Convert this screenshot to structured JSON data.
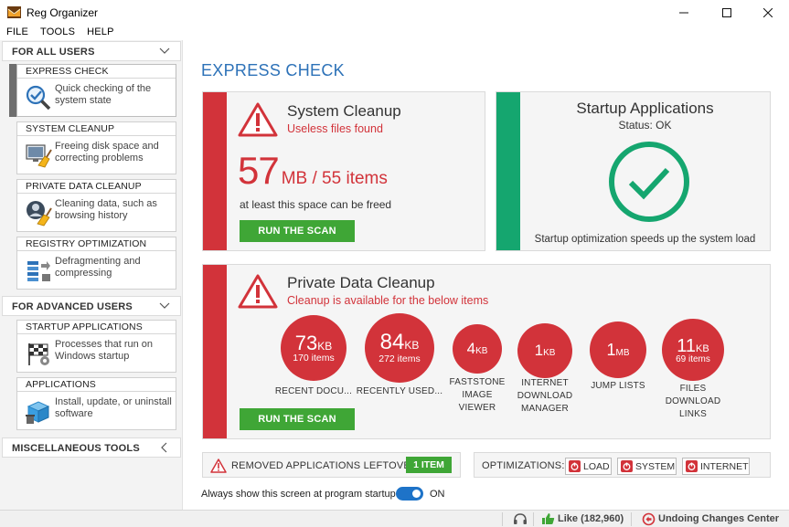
{
  "window": {
    "title": "Reg Organizer"
  },
  "menu": [
    "FILE",
    "TOOLS",
    "HELP"
  ],
  "sidebar": {
    "for_all_users": "FOR ALL USERS",
    "for_advanced_users": "FOR ADVANCED USERS",
    "misc_tools": "MISCELLANEOUS TOOLS",
    "items": [
      {
        "title": "EXPRESS CHECK",
        "desc": "Quick checking of the system state"
      },
      {
        "title": "SYSTEM CLEANUP",
        "desc": "Freeing disk space and correcting problems"
      },
      {
        "title": "PRIVATE DATA CLEANUP",
        "desc": "Cleaning data, such as browsing history"
      },
      {
        "title": "REGISTRY OPTIMIZATION",
        "desc": "Defragmenting and compressing"
      },
      {
        "title": "STARTUP APPLICATIONS",
        "desc": "Processes that run on Windows startup"
      },
      {
        "title": "APPLICATIONS",
        "desc": "Install, update, or uninstall software"
      }
    ]
  },
  "main": {
    "page_title": "EXPRESS CHECK",
    "system_cleanup": {
      "title": "System Cleanup",
      "subtitle": "Useless files found",
      "amount": "57",
      "amount_unit": "MB / 55 items",
      "note": "at least this space can be freed",
      "button": "RUN THE SCAN"
    },
    "startup_apps": {
      "title": "Startup Applications",
      "status": "Status: OK",
      "note": "Startup optimization speeds up the system load"
    },
    "private_data": {
      "title": "Private Data Cleanup",
      "subtitle": "Cleanup is available for the below items",
      "button": "RUN THE SCAN",
      "items": [
        {
          "value": "73",
          "unit": "KB",
          "items": "170 items",
          "label": "RECENT DOCU..."
        },
        {
          "value": "84",
          "unit": "KB",
          "items": "272 items",
          "label": "RECENTLY USED..."
        },
        {
          "value": "4",
          "unit": "KB",
          "items": "",
          "label": "FASTSTONE IMAGE VIEWER"
        },
        {
          "value": "1",
          "unit": "KB",
          "items": "",
          "label": "INTERNET DOWNLOAD MANAGER"
        },
        {
          "value": "1",
          "unit": "MB",
          "items": "",
          "label": "JUMP LISTS"
        },
        {
          "value": "11",
          "unit": "KB",
          "items": "69 items",
          "label": "FILES DOWNLOAD LINKS"
        }
      ]
    },
    "leftovers": {
      "label": "REMOVED APPLICATIONS LEFTOVERS",
      "badge": "1 ITEM"
    },
    "optimizations": {
      "label": "OPTIMIZATIONS:",
      "buttons": [
        "LOAD",
        "SYSTEM",
        "INTERNET"
      ]
    },
    "startup_toggle": {
      "label": "Always show this screen at program startup",
      "state": "ON"
    }
  },
  "statusbar": {
    "like": "Like (182,960)",
    "undo": "Undoing Changes Center"
  },
  "colors": {
    "accent_red": "#d2333a",
    "accent_green": "#15a66f",
    "button_green": "#3fa636",
    "title_blue": "#2d72b8"
  }
}
